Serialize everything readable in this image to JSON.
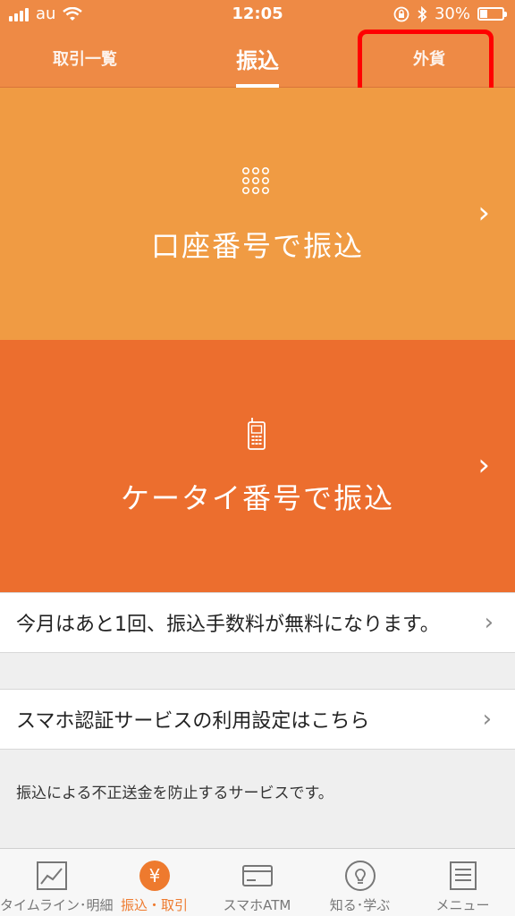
{
  "status_bar": {
    "carrier": "au",
    "time": "12:05",
    "battery": "30%"
  },
  "tabs": [
    {
      "label": "取引一覧"
    },
    {
      "label": "振込",
      "active": true
    },
    {
      "label": "外貨"
    }
  ],
  "panels": [
    {
      "label": "口座番号で振込",
      "icon": "keypad-icon"
    },
    {
      "label": "ケータイ番号で振込",
      "icon": "mobile-phone-icon"
    }
  ],
  "rows": {
    "fee_notice": "今月はあと1回、振込手数料が無料になります。",
    "auth_setting": "スマホ認証サービスの利用設定はこちら"
  },
  "note": "振込による不正送金を防止するサービスです。",
  "bottom_nav": [
    {
      "label": "タイムライン･明細",
      "icon": "chart-icon"
    },
    {
      "label": "振込・取引",
      "icon": "yen-icon",
      "active": true
    },
    {
      "label": "スマホATM",
      "icon": "card-icon"
    },
    {
      "label": "知る･学ぶ",
      "icon": "lightbulb-icon"
    },
    {
      "label": "メニュー",
      "icon": "menu-list-icon"
    }
  ],
  "colors": {
    "header": "#ee8a45",
    "panel1": "#f09b43",
    "panel2": "#ec6e2e",
    "accent": "#ee7a2e",
    "highlight": "#ff0000"
  }
}
